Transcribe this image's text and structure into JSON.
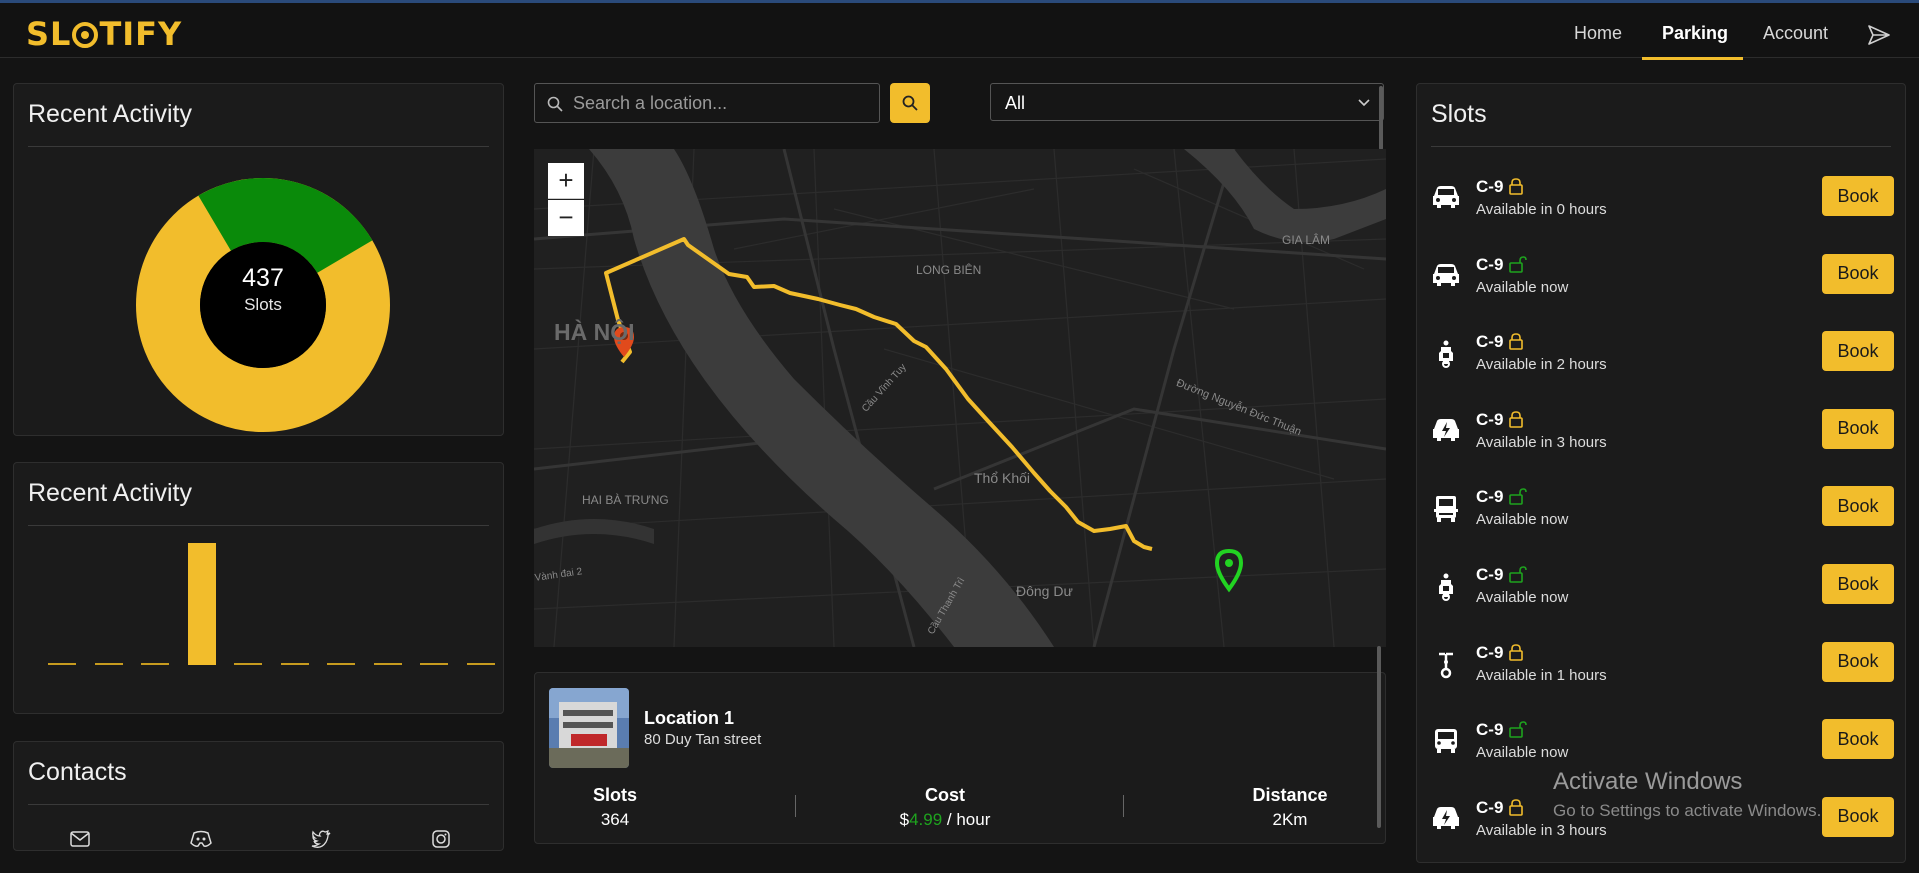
{
  "app": {
    "logo_text_left": "SL",
    "logo_text_right": "TIFY",
    "accent": "#f2bd2c"
  },
  "nav": {
    "home": "Home",
    "parking": "Parking",
    "account": "Account",
    "send_icon": "send-icon"
  },
  "activity_card": {
    "title": "Recent Activity",
    "total": "437",
    "unit": "Slots",
    "donut": {
      "segments": [
        {
          "color": "#f2bd2c",
          "fraction": 0.75
        },
        {
          "color": "#0a8a0a",
          "fraction": 0.25
        }
      ]
    }
  },
  "bar_card": {
    "title": "Recent Activity",
    "chart_data": {
      "type": "bar",
      "values": [
        0,
        0,
        0,
        1,
        0,
        0,
        0,
        0,
        0,
        0
      ],
      "color": "#f2bd2c"
    }
  },
  "contacts": {
    "title": "Contacts",
    "icons": [
      "mail-icon",
      "discord-icon",
      "twitter-icon",
      "instagram-icon"
    ]
  },
  "search": {
    "placeholder": "Search a location..."
  },
  "filter": {
    "selected": "All"
  },
  "map": {
    "labels": {
      "long_bien": "LONG BIÊN",
      "gia_lam": "GIA LÂM",
      "ha_noi": "HÀ NỘI",
      "hai_ba_trung": "HAI BÀ TRƯNG",
      "tho_khoi": "Thổ Khối",
      "dong_du": "Đông Dư",
      "duong_nguyen": "Đường Nguyễn Đức Thuận",
      "cau_vinh_tuy": "Cầu Vĩnh Tuy",
      "vanh_dai": "Vành đai 2",
      "cau_thanh_tri": "Cầu Thanh Trì"
    },
    "zoom_in": "+",
    "zoom_out": "−"
  },
  "location": {
    "name": "Location 1",
    "address": "80 Duy Tan street",
    "slots_label": "Slots",
    "slots_value": "364",
    "cost_label": "Cost",
    "cost_currency": "$",
    "cost_value": "4.99",
    "cost_unit": "/ hour",
    "distance_label": "Distance",
    "distance_value": "2Km"
  },
  "slots": {
    "title": "Slots",
    "items": [
      {
        "code": "C-9",
        "status": "Available in 0 hours",
        "vehicle": "car-icon",
        "lock": "locked",
        "book": "Book"
      },
      {
        "code": "C-9",
        "status": "Available now",
        "vehicle": "car-icon",
        "lock": "unlocked",
        "book": "Book"
      },
      {
        "code": "C-9",
        "status": "Available in 2 hours",
        "vehicle": "scooter-icon",
        "lock": "locked",
        "book": "Book"
      },
      {
        "code": "C-9",
        "status": "Available in 3 hours",
        "vehicle": "electric-car-icon",
        "lock": "locked",
        "book": "Book"
      },
      {
        "code": "C-9",
        "status": "Available now",
        "vehicle": "truck-icon",
        "lock": "unlocked",
        "book": "Book"
      },
      {
        "code": "C-9",
        "status": "Available now",
        "vehicle": "scooter-icon",
        "lock": "unlocked",
        "book": "Book"
      },
      {
        "code": "C-9",
        "status": "Available in 1 hours",
        "vehicle": "bicycle-icon",
        "lock": "locked",
        "book": "Book"
      },
      {
        "code": "C-9",
        "status": "Available now",
        "vehicle": "van-icon",
        "lock": "unlocked",
        "book": "Book"
      },
      {
        "code": "C-9",
        "status": "Available in 3 hours",
        "vehicle": "electric-car-icon",
        "lock": "locked",
        "book": "Book"
      }
    ]
  },
  "watermark": {
    "line1": "Activate Windows",
    "line2": "Go to Settings to activate Windows."
  }
}
